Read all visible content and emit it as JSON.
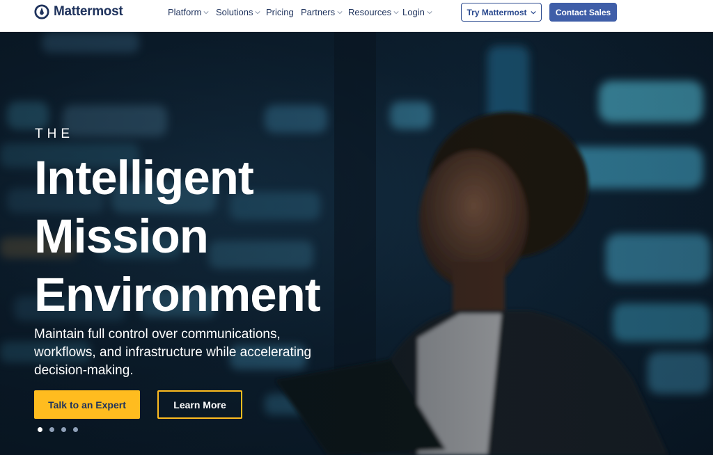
{
  "brand": {
    "name": "Mattermost",
    "logo_icon": "mattermost-logo-icon"
  },
  "nav": {
    "items": [
      {
        "label": "Platform",
        "has_dropdown": true
      },
      {
        "label": "Solutions",
        "has_dropdown": true
      },
      {
        "label": "Pricing",
        "has_dropdown": false
      },
      {
        "label": "Partners",
        "has_dropdown": true
      },
      {
        "label": "Resources",
        "has_dropdown": true
      },
      {
        "label": "Login",
        "has_dropdown": true
      }
    ],
    "try_label": "Try Mattermost",
    "contact_label": "Contact Sales"
  },
  "hero": {
    "eyebrow": "THE",
    "headline_lines": [
      "Intelligent",
      "Mission",
      "Environment"
    ],
    "subtext": "Maintain full control over communications, workflows, and infrastructure while accelerating decision-making.",
    "primary_cta": "Talk to an Expert",
    "secondary_cta": "Learn More",
    "carousel": {
      "count": 4,
      "active_index": 0
    }
  },
  "colors": {
    "brand_navy": "#1e325c",
    "primary_blue": "#3f5ea8",
    "cta_yellow": "#ffbc1f",
    "hero_dark": "#0e2233"
  }
}
